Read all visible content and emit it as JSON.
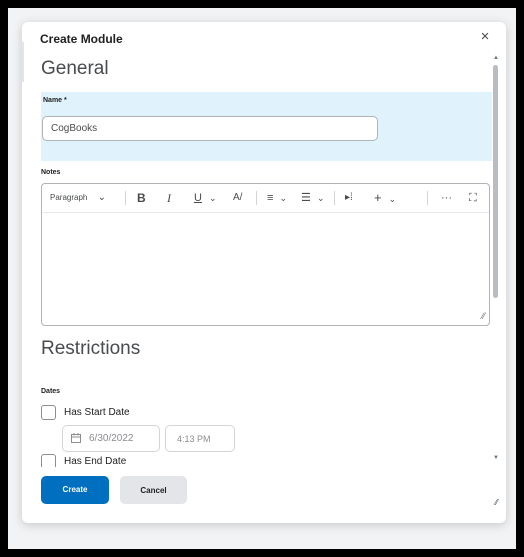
{
  "dialog": {
    "title": "Create Module",
    "close_glyph": "×"
  },
  "general": {
    "heading": "General",
    "name_label": "Name *",
    "name_value": "CogBooks"
  },
  "notes": {
    "label": "Notes",
    "toolbar": {
      "paragraph": "Paragraph",
      "paragraph_caret": "⌄",
      "bold": "B",
      "italic": "I",
      "underline": "U",
      "underline_caret": "⌄",
      "font_color": "A/",
      "align": "≡",
      "align_caret": "⌄",
      "list": "☰",
      "list_caret": "⌄",
      "insert_media": "▸⁞",
      "insert": "+",
      "insert_caret": "⌄",
      "more": "···",
      "fullscreen": "⛶"
    },
    "resize_glyph": "⁄⁄"
  },
  "restrictions": {
    "heading": "Restrictions",
    "dates_label": "Dates",
    "start_date_label": "Has Start Date",
    "start_date_value": "6/30/2022",
    "start_time_value": "4:13 PM",
    "end_date_label": "Has End Date"
  },
  "footer": {
    "create_label": "Create",
    "cancel_label": "Cancel"
  },
  "colors": {
    "primary": "#006fbf",
    "highlight_band": "#e0f2fb"
  }
}
